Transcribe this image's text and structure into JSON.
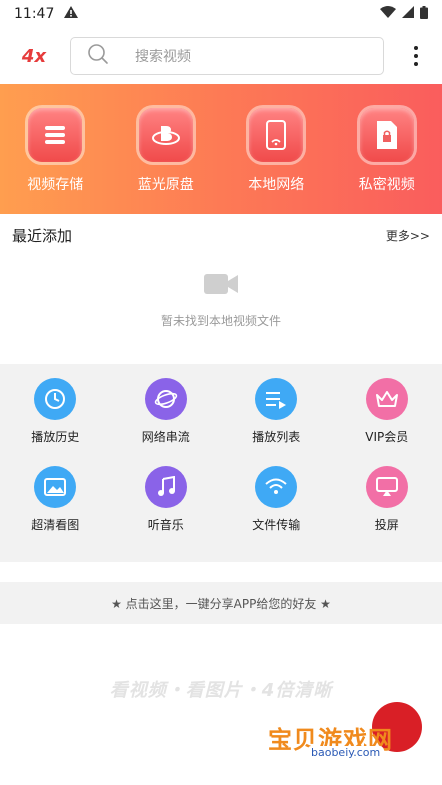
{
  "status": {
    "time": "11:47"
  },
  "header": {
    "logo_text": "4x",
    "search_placeholder": "搜索视频"
  },
  "banner": {
    "colors": {
      "start": "#ff9e4f",
      "end": "#fa5d5d"
    },
    "items": [
      {
        "label": "视频存储",
        "icon": "list-icon"
      },
      {
        "label": "蓝光原盘",
        "icon": "bluray-icon"
      },
      {
        "label": "本地网络",
        "icon": "phone-wifi-icon"
      },
      {
        "label": "私密视频",
        "icon": "lock-file-icon"
      }
    ]
  },
  "recent": {
    "title": "最近添加",
    "more": "更多>>",
    "empty_text": "暂未找到本地视频文件"
  },
  "features": [
    {
      "label": "播放历史",
      "icon": "clock-icon",
      "color": "#3fa9f5"
    },
    {
      "label": "网络串流",
      "icon": "globe-icon",
      "color": "#8a63e8"
    },
    {
      "label": "播放列表",
      "icon": "playlist-icon",
      "color": "#3fa9f5"
    },
    {
      "label": "VIP会员",
      "icon": "crown-icon",
      "color": "#f26fa6"
    },
    {
      "label": "超清看图",
      "icon": "image-icon",
      "color": "#3fa9f5"
    },
    {
      "label": "听音乐",
      "icon": "music-icon",
      "color": "#8a63e8"
    },
    {
      "label": "文件传输",
      "icon": "wifi-icon",
      "color": "#3fa9f5"
    },
    {
      "label": "投屏",
      "icon": "cast-icon",
      "color": "#f26fa6"
    }
  ],
  "share_text": "★ 点击这里，一键分享APP给您的好友 ★",
  "slogan": "看视频・看图片・4倍清晰",
  "watermark": {
    "text": "宝贝游戏网",
    "url": "baobeiy.com"
  }
}
